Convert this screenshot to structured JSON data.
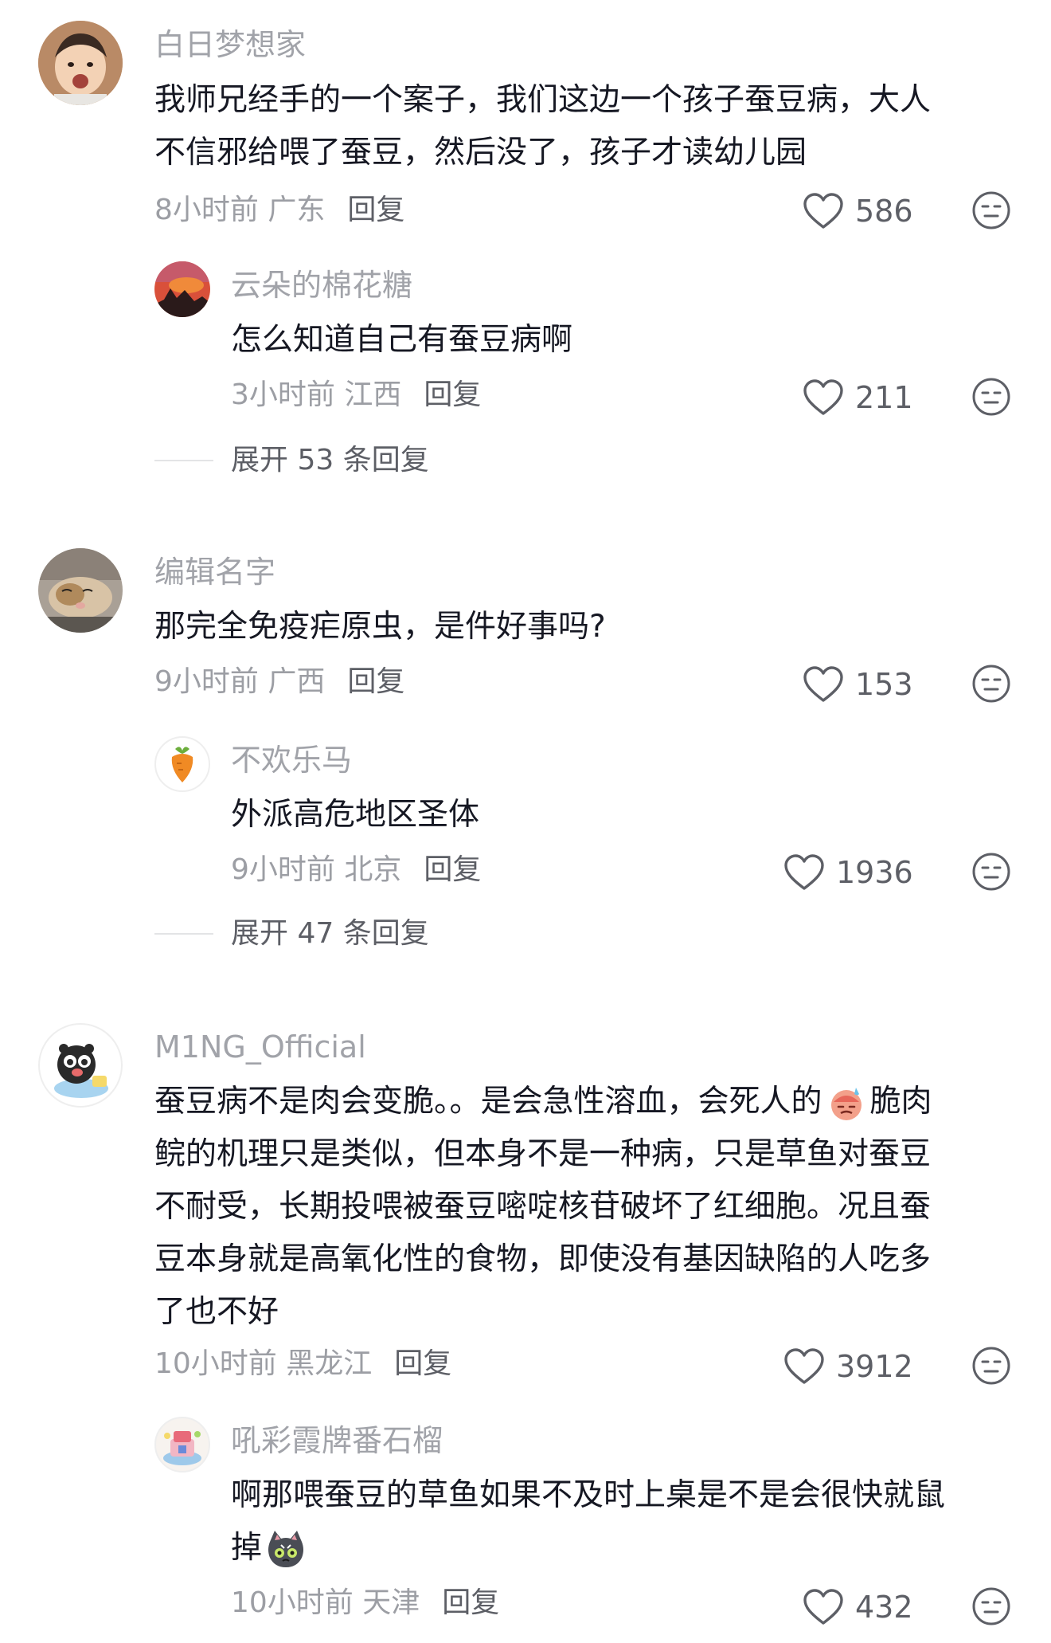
{
  "comments": [
    {
      "author": "白日梦想家",
      "line1": "我师兄经手的一个案子，我们这边一个孩子蚕豆病，大人",
      "line2": "不信邪给喂了蚕豆，然后没了，孩子才读幼儿园",
      "time_location": "8小时前 广东",
      "reply_label": "回复",
      "likes": "586",
      "sub": {
        "author": "云朵的棉花糖",
        "text": "怎么知道自己有蚕豆病啊",
        "time_location": "3小时前 江西",
        "reply_label": "回复",
        "likes": "211"
      },
      "expand_label": "展开 53 条回复"
    },
    {
      "author": "编辑名字",
      "text": "那完全免疫疟原虫，是件好事吗?",
      "time_location": "9小时前 广西",
      "reply_label": "回复",
      "likes": "153",
      "sub": {
        "author": "不欢乐马",
        "text": "外派高危地区圣体",
        "time_location": "9小时前 北京",
        "reply_label": "回复",
        "likes": "1936"
      },
      "expand_label": "展开 47 条回复"
    },
    {
      "author": "M1NG_Official",
      "line1a": "蚕豆病不是肉会变脆。。是会急性溶血，会死人的",
      "line1b": "脆肉",
      "line2": "鲩的机理只是类似，但本身不是一种病，只是草鱼对蚕豆",
      "line3": "不耐受，长期投喂被蚕豆嘧啶核苷破坏了红细胞。况且蚕",
      "line4": "豆本身就是高氧化性的食物，即使没有基因缺陷的人吃多",
      "line5": "了也不好",
      "time_location": "10小时前 黑龙江",
      "reply_label": "回复",
      "likes": "3912",
      "sub": {
        "author": "吼彩霞牌番石榴",
        "line1": "啊那喂蚕豆的草鱼如果不及时上桌是不是会很快就鼠",
        "line2": "掉",
        "time_location": "10小时前 天津",
        "reply_label": "回复",
        "likes": "432"
      }
    }
  ],
  "icons": {
    "like": "heart-outline-icon",
    "dislike": "meh-face-icon"
  },
  "colors": {
    "name": "#a1a3a9",
    "text": "#161823",
    "meta": "#9c9ea4",
    "action": "#5d5f66"
  }
}
